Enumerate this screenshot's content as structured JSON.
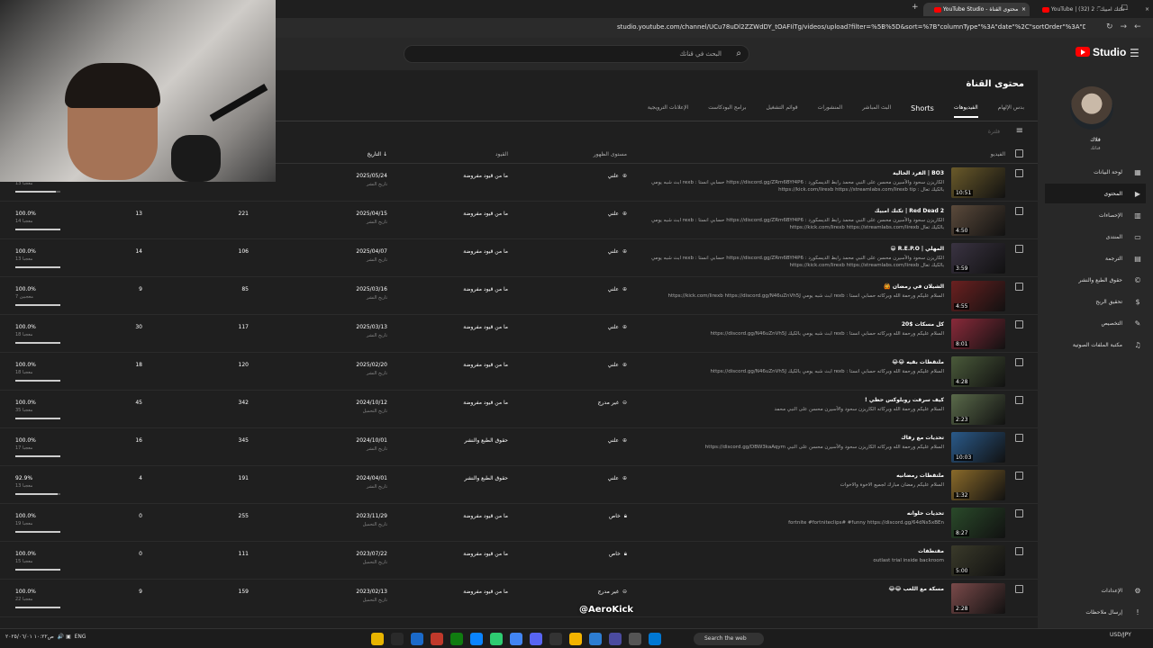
{
  "browser": {
    "tabs": [
      {
        "label": "YouTube | (32) تكتك امبيك : 2 -",
        "active": false
      },
      {
        "label": "YouTube Studio - محتوى القناة",
        "active": true
      }
    ],
    "url": "studio.youtube.com/channel/UCu78uDl2ZZWdDY_tOAFIiTg/videos/upload?filter=%5B%5D&sort=%7B\"columnType\"%3A\"date\"%2C\"sortOrder\"%3A\"DESCENDING\"%7D"
  },
  "studio": {
    "logo_text": "Studio",
    "search_placeholder": "البحث في قناتك",
    "page_title": "محتوى القناة",
    "tabs": [
      "بدس الإلهام",
      "الفيديوهات",
      "Shorts",
      "البث المباشر",
      "المنشورات",
      "قوائم التشغيل",
      "برامج البودكاست",
      "الإعلانات الترويجية"
    ],
    "active_tab": "الفيديوهات",
    "filter_label": "فلترة",
    "columns": {
      "video": "الفيديو",
      "visibility": "مستوى الظهور",
      "restrictions": "القيود",
      "date": "التاريخ ↓",
      "views": "",
      "comments": "",
      "likes": ""
    },
    "rows": [
      {
        "title": "BO3 | الفرد الحالية",
        "desc": "الكاريزن سحود والأسيرن محسن على النبي محمد رابط الديسكورد : https://discord.gg/ZRm6BYf4P6 حسابي انستا : rexb ابث شبه يومي بالكيك تعال : https://kick.com/lirexb https://streamlabs.com/lirexb tip",
        "duration": "10:51",
        "visibility": "علني",
        "restriction": "ما من قيود مفروضة",
        "date": "2025/05/24",
        "date_sub": "تاريخ النشر",
        "views": "",
        "comments": "",
        "likes_pct": "",
        "likes_sub": "13 معجبا",
        "fill": 0.9,
        "thumb": "#6a5a2a"
      },
      {
        "title": "Red Dead 2 | تكتك امبيك",
        "desc": "الكاريزن سحود والأسيرن محسن على النبي محمد رابط الديسكورد : https://discord.gg/ZRm6BYf4P6 حسابي انستا : rexb ابث شبه يومي بالكيك تعال https://kick.com/lirexb https://streamlabs.com/lirexb",
        "duration": "4:50",
        "visibility": "علني",
        "restriction": "ما من قيود مفروضة",
        "date": "2025/04/15",
        "date_sub": "تاريخ النشر",
        "views": "221",
        "comments": "13",
        "likes_pct": "100.0%",
        "likes_sub": "14 معجبا",
        "fill": 1.0,
        "thumb": "#5b4a3b"
      },
      {
        "title": "المهلي | R.E.P.O 😁",
        "desc": "الكاريزن سحود والأسيرن محسن على النبي محمد رابط الديسكورد : https://discord.gg/ZRm6BYf4P6 حسابي انستا : rexb ابث شبه يومي بالكيك تعال https://kick.com/lirexb https://streamlabs.com/lirexb",
        "duration": "3:59",
        "visibility": "علني",
        "restriction": "ما من قيود مفروضة",
        "date": "2025/04/07",
        "date_sub": "تاريخ النشر",
        "views": "106",
        "comments": "14",
        "likes_pct": "100.0%",
        "likes_sub": "13 معجبا",
        "fill": 1.0,
        "thumb": "#3a3342"
      },
      {
        "title": "الشيلان في رمضان 🙆",
        "desc": "السلام عليكم ورحمة الله وبركاته حسابي انستا : rexb ابث شبه يومي https://kick.com/lirexb https://discord.gg/N46uZnVh5J",
        "duration": "4:55",
        "visibility": "علني",
        "restriction": "ما من قيود مفروضة",
        "date": "2025/03/16",
        "date_sub": "تاريخ النشر",
        "views": "85",
        "comments": "9",
        "likes_pct": "100.0%",
        "likes_sub": "7 معجبين",
        "fill": 1.0,
        "thumb": "#6b2020"
      },
      {
        "title": "كل مسكات $20",
        "desc": "السلام عليكم ورحمة الله وبركاته حسابي انستا : rexb ابث شبه يومي بالكيك https://discord.gg/N46uZnVh5J",
        "duration": "8:01",
        "visibility": "علني",
        "restriction": "ما من قيود مفروضة",
        "date": "2025/03/13",
        "date_sub": "تاريخ النشر",
        "views": "117",
        "comments": "30",
        "likes_pct": "100.0%",
        "likes_sub": "18 معجبا",
        "fill": 1.0,
        "thumb": "#8a2a3a"
      },
      {
        "title": "ملتقطات بقيه 😂😂",
        "desc": "السلام عليكم ورحمة الله وبركاته حسابي انستا : rexb ابث شبه يومي بالكيك https://discord.gg/N46uZnVh5J",
        "duration": "4:28",
        "visibility": "علني",
        "restriction": "ما من قيود مفروضة",
        "date": "2025/02/20",
        "date_sub": "تاريخ النشر",
        "views": "120",
        "comments": "18",
        "likes_pct": "100.0%",
        "likes_sub": "18 معجبا",
        "fill": 1.0,
        "thumb": "#4a5a3a"
      },
      {
        "title": "كيف سرقت روبلوكس حظي !",
        "desc": "السلام عليكم ورحمة الله وبركاته الكاريزن سحود والأسيرن محسن على النبي محمد",
        "duration": "2:23",
        "visibility": "غير مدرج",
        "restriction": "ما من قيود مفروضة",
        "date": "2024/10/12",
        "date_sub": "تاريخ التحميل",
        "views": "342",
        "comments": "45",
        "likes_pct": "100.0%",
        "likes_sub": "35 معجبا",
        "fill": 1.0,
        "thumb": "#5a6a4a"
      },
      {
        "title": "تحديات مع رفاك",
        "desc": "السلام عليكم ورحمة الله وبركاته الكاريزن سحود والأسيرن محسن على النبي https://discord.gg/DBW3kaAqym",
        "duration": "10:03",
        "visibility": "علني",
        "restriction": "حقوق الطبع والنشر",
        "date": "2024/10/01",
        "date_sub": "تاريخ النشر",
        "views": "345",
        "comments": "16",
        "likes_pct": "100.0%",
        "likes_sub": "17 معجبا",
        "fill": 1.0,
        "thumb": "#2a5a8a"
      },
      {
        "title": "ملتقطات رمضانيه",
        "desc": "السلام عليكم رمضان مبارك لجميع الاخوة والاخوات",
        "duration": "1:32",
        "visibility": "علني",
        "restriction": "حقوق الطبع والنشر",
        "date": "2024/04/01",
        "date_sub": "تاريخ النشر",
        "views": "191",
        "comments": "4",
        "likes_pct": "92.9%",
        "likes_sub": "13 معجبا",
        "fill": 0.93,
        "thumb": "#8a6a2a"
      },
      {
        "title": "تحديات حلوانه",
        "desc": "fortnite #fortniteclips# #funny https://discord.gg/64dNs5xBEn",
        "duration": "8:27",
        "visibility": "خاص",
        "restriction": "ما من قيود مفروضة",
        "date": "2023/11/29",
        "date_sub": "تاريخ التحميل",
        "views": "255",
        "comments": "0",
        "likes_pct": "100.0%",
        "likes_sub": "19 معجبا",
        "fill": 1.0,
        "thumb": "#2a4a2a"
      },
      {
        "title": "مقتطفات",
        "desc": "outlast trial inside backroom",
        "duration": "5:00",
        "visibility": "خاص",
        "restriction": "ما من قيود مفروضة",
        "date": "2023/07/22",
        "date_sub": "تاريخ التحميل",
        "views": "111",
        "comments": "0",
        "likes_pct": "100.0%",
        "likes_sub": "15 معجبا",
        "fill": 1.0,
        "thumb": "#3a3a2a"
      },
      {
        "title": "مسكة مع اللعب 😂😂",
        "desc": "",
        "duration": "2:28",
        "visibility": "غير مدرج",
        "restriction": "ما من قيود مفروضة",
        "date": "2023/02/13",
        "date_sub": "تاريخ التحميل",
        "views": "159",
        "comments": "9",
        "likes_pct": "100.0%",
        "likes_sub": "22 معجبا",
        "fill": 1.0,
        "thumb": "#7a4a4a"
      }
    ]
  },
  "sidebar": {
    "channel_name": "فلاك",
    "channel_sub": "قناتك",
    "items": [
      {
        "label": "لوحة البيانات",
        "icon": "dashboard-icon",
        "glyph": "▦",
        "active": false
      },
      {
        "label": "المحتوى",
        "icon": "content-icon",
        "glyph": "▶",
        "active": true
      },
      {
        "label": "الإحصاءات",
        "icon": "analytics-icon",
        "glyph": "▥",
        "active": false
      },
      {
        "label": "المنتدى",
        "icon": "community-icon",
        "glyph": "▭",
        "active": false
      },
      {
        "label": "الترجمة",
        "icon": "subtitles-icon",
        "glyph": "▤",
        "active": false
      },
      {
        "label": "حقوق الطبع والنشر",
        "icon": "copyright-icon",
        "glyph": "©",
        "active": false
      },
      {
        "label": "تحقيق الربح",
        "icon": "monetization-icon",
        "glyph": "$",
        "active": false
      },
      {
        "label": "التخصيص",
        "icon": "customization-icon",
        "glyph": "✎",
        "active": false
      },
      {
        "label": "مكتبة الملفات الصوتية",
        "icon": "audio-library-icon",
        "glyph": "♫",
        "active": false
      }
    ],
    "bottom_items": [
      {
        "label": "الإعدادات",
        "icon": "settings-icon",
        "glyph": "⚙"
      },
      {
        "label": "إرسال ملاحظات",
        "icon": "feedback-icon",
        "glyph": "!"
      }
    ]
  },
  "overlay": {
    "handle": "@AeroKick"
  },
  "taskbar": {
    "left_text": "ص١٠:٢٢  ٢٠٢٥/٠٦/٠١",
    "lang": "ENG",
    "search": "Search the web",
    "currency": "USD/JPY"
  }
}
